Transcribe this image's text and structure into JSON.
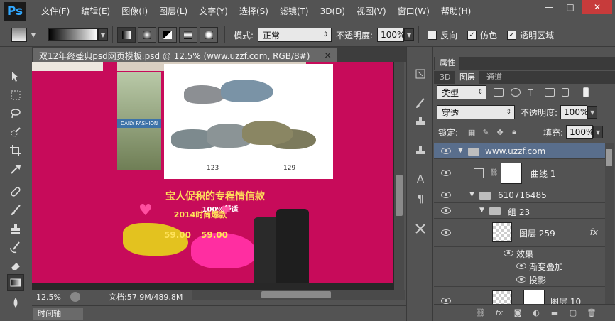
{
  "app": {
    "logo": "Ps"
  },
  "menu": [
    "文件(F)",
    "编辑(E)",
    "图像(I)",
    "图层(L)",
    "文字(Y)",
    "选择(S)",
    "滤镜(T)",
    "3D(D)",
    "视图(V)",
    "窗口(W)",
    "帮助(H)"
  ],
  "window_controls": {
    "minimize": "—",
    "maximize": "□",
    "close": "✕"
  },
  "options": {
    "mode_label": "模式:",
    "mode_value": "正常",
    "opacity_label": "不透明度:",
    "opacity_value": "100%",
    "reverse_label": "反向",
    "dither_label": "仿色",
    "transparency_label": "透明区域",
    "reverse_checked": false,
    "dither_checked": true,
    "transparency_checked": true
  },
  "document": {
    "tab_title": "双12年终盛典psd网页模板.psd @ 12.5% (www.uzzf.com, RGB/8#)",
    "close": "×",
    "zoom": "12.5%",
    "doc_info": "文档:57.9M/489.8M",
    "canvas_color": "#c70b5a"
  },
  "artwork": {
    "left_label": "DAILY FASHION",
    "promo_title": "宝人促积的专程情信款",
    "promo_sub": "100%舒适",
    "promo_year": "2014时尚爆款",
    "price_a": "123",
    "price_b": "129",
    "price_c": "59.00",
    "price_d": "59.00"
  },
  "timeline": {
    "label": "时间轴"
  },
  "panel": {
    "properties_tab": "属性",
    "tabs": [
      "3D",
      "图层",
      "通道"
    ],
    "active_tab": "图层",
    "filter_label": "类型",
    "blend_value": "穿透",
    "opacity_label": "不透明度:",
    "opacity_value": "100%",
    "lock_label": "锁定:",
    "fill_label": "填充:",
    "fill_value": "100%"
  },
  "layers": [
    {
      "name": "www.uzzf.com",
      "type": "group",
      "selected": true
    },
    {
      "name": "曲线 1",
      "type": "adjustment"
    },
    {
      "name": "610716485",
      "type": "group"
    },
    {
      "name": "组 23",
      "type": "group"
    },
    {
      "name": "图层 259",
      "type": "layer",
      "fx": "fx"
    },
    {
      "name": "效果",
      "type": "effects"
    },
    {
      "name": "渐变叠加",
      "type": "effect"
    },
    {
      "name": "投影",
      "type": "effect"
    },
    {
      "name": "图层 10",
      "type": "layer"
    }
  ]
}
